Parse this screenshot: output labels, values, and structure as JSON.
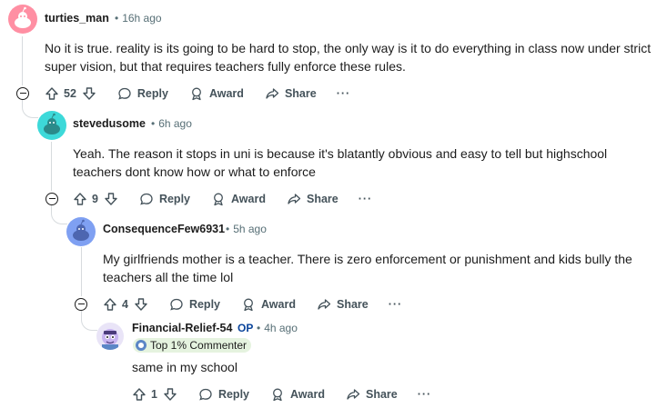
{
  "comments": [
    {
      "username": "turties_man",
      "time": "16h ago",
      "body": "No it is true. reality is its going to be hard to stop, the only way is it to do everything in class now under strict super vision, but that requires teachers fully enforce these rules.",
      "votes": "52",
      "avatar_color": "#ff8fa3"
    },
    {
      "username": "stevedusome",
      "time": "6h ago",
      "body": "Yeah. The reason it stops in uni is because it's blatantly obvious and easy to tell but highschool teachers dont know how or what to enforce",
      "votes": "9",
      "avatar_color": "#3dd9d9"
    },
    {
      "username": "ConsequenceFew6931",
      "time": "5h ago",
      "body": "My girlfriends mother is a teacher. There is zero enforcement or punishment and kids bully the teachers all the time lol",
      "votes": "4",
      "avatar_color": "#7fa0f2"
    },
    {
      "username": "Financial-Relief-54",
      "op_label": "OP",
      "time": "4h ago",
      "badge": "Top 1% Commenter",
      "body": "same in my school",
      "votes": "1",
      "avatar_color": "#c7b3f0"
    }
  ],
  "actions": {
    "reply": "Reply",
    "award": "Award",
    "share": "Share",
    "more": "···"
  },
  "icons": [
    "upvote-icon",
    "downvote-icon",
    "reply-icon",
    "award-icon",
    "share-icon",
    "collapse-icon"
  ]
}
